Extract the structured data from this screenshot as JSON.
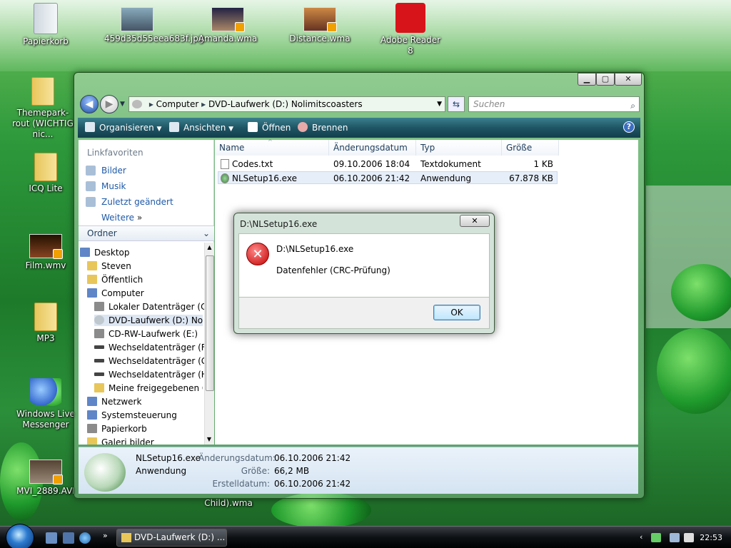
{
  "desktop": {
    "icons": [
      {
        "label": "Papierkorb"
      },
      {
        "label": "459d35d55eea683f.jpg"
      },
      {
        "label": "Amanda.wma"
      },
      {
        "label": "Distance.wma"
      },
      {
        "label": "Adobe Reader 8"
      },
      {
        "label": "Themepark-rout (WICHTIG nic..."
      },
      {
        "label": "ICQ Lite"
      },
      {
        "label": "Film.wmv"
      },
      {
        "label": "MP3"
      },
      {
        "label": "Windows Live Messenger"
      },
      {
        "label": "MVI_2889.AVI"
      },
      {
        "label": "Child).wma"
      }
    ]
  },
  "explorer": {
    "address": {
      "root": "Computer",
      "current": "DVD-Laufwerk (D:) Nolimitscoasters"
    },
    "search_placeholder": "Suchen",
    "toolbar": {
      "organisieren": "Organisieren",
      "ansichten": "Ansichten",
      "oeffnen": "Öffnen",
      "brennen": "Brennen"
    },
    "linkfavoriten": {
      "header": "Linkfavoriten",
      "items": [
        "Bilder",
        "Musik",
        "Zuletzt geändert",
        "Weitere"
      ]
    },
    "ordner_label": "Ordner",
    "tree": [
      "Desktop",
      "Steven",
      "Öffentlich",
      "Computer",
      "Lokaler Datenträger (C:)",
      "DVD-Laufwerk (D:) Nolim",
      "CD-RW-Laufwerk (E:)",
      "Wechseldatenträger (F:)",
      "Wechseldatenträger (G:)",
      "Wechseldatenträger (H:)",
      "Meine freigegebenen Or",
      "Netzwerk",
      "Systemsteuerung",
      "Papierkorb",
      "Galeri bilder"
    ],
    "columns": [
      "Name",
      "Änderungsdatum",
      "Typ",
      "Größe"
    ],
    "files": [
      {
        "name": "Codes.txt",
        "date": "09.10.2006 18:04",
        "type": "Textdokument",
        "size": "1 KB"
      },
      {
        "name": "NLSetup16.exe",
        "date": "06.10.2006 21:42",
        "type": "Anwendung",
        "size": "67.878 KB"
      }
    ],
    "details": {
      "name": "NLSetup16.exe",
      "type": "Anwendung",
      "label_modified": "Änderungsdatum:",
      "modified": "06.10.2006 21:42",
      "label_size": "Größe:",
      "size": "66,2 MB",
      "label_created": "Erstelldatum:",
      "created": "06.10.2006 21:42"
    }
  },
  "dialog": {
    "title": "D:\\NLSetup16.exe",
    "path": "D:\\NLSetup16.exe",
    "message": "Datenfehler (CRC-Prüfung)",
    "ok": "OK"
  },
  "taskbar": {
    "task_label": "DVD-Laufwerk (D:) ...",
    "clock": "22:53"
  },
  "colors": {
    "toolbar": "#1f5565",
    "link": "#1e5aa8",
    "error": "#c40000"
  }
}
